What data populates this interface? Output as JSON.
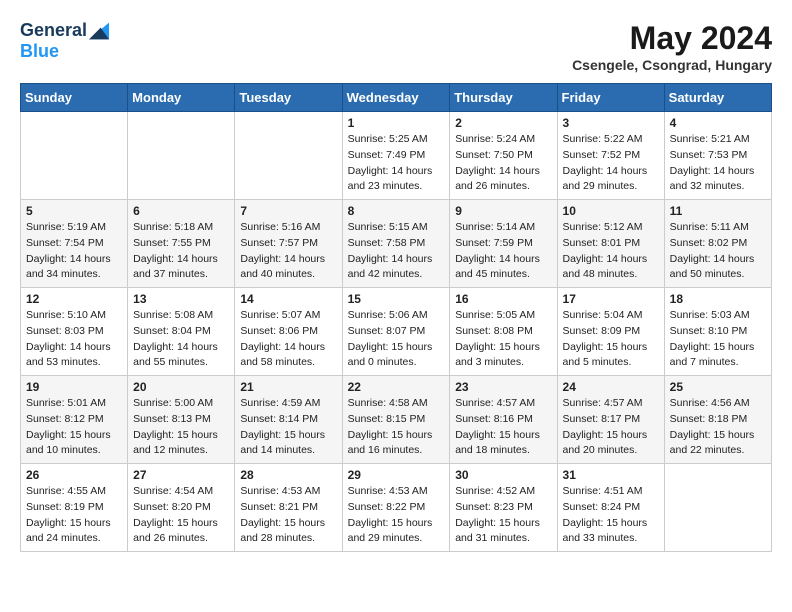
{
  "header": {
    "logo_general": "General",
    "logo_blue": "Blue",
    "month_year": "May 2024",
    "location": "Csengele, Csongrad, Hungary"
  },
  "weekdays": [
    "Sunday",
    "Monday",
    "Tuesday",
    "Wednesday",
    "Thursday",
    "Friday",
    "Saturday"
  ],
  "weeks": [
    [
      {
        "day": "",
        "info": ""
      },
      {
        "day": "",
        "info": ""
      },
      {
        "day": "",
        "info": ""
      },
      {
        "day": "1",
        "info": "Sunrise: 5:25 AM\nSunset: 7:49 PM\nDaylight: 14 hours\nand 23 minutes."
      },
      {
        "day": "2",
        "info": "Sunrise: 5:24 AM\nSunset: 7:50 PM\nDaylight: 14 hours\nand 26 minutes."
      },
      {
        "day": "3",
        "info": "Sunrise: 5:22 AM\nSunset: 7:52 PM\nDaylight: 14 hours\nand 29 minutes."
      },
      {
        "day": "4",
        "info": "Sunrise: 5:21 AM\nSunset: 7:53 PM\nDaylight: 14 hours\nand 32 minutes."
      }
    ],
    [
      {
        "day": "5",
        "info": "Sunrise: 5:19 AM\nSunset: 7:54 PM\nDaylight: 14 hours\nand 34 minutes."
      },
      {
        "day": "6",
        "info": "Sunrise: 5:18 AM\nSunset: 7:55 PM\nDaylight: 14 hours\nand 37 minutes."
      },
      {
        "day": "7",
        "info": "Sunrise: 5:16 AM\nSunset: 7:57 PM\nDaylight: 14 hours\nand 40 minutes."
      },
      {
        "day": "8",
        "info": "Sunrise: 5:15 AM\nSunset: 7:58 PM\nDaylight: 14 hours\nand 42 minutes."
      },
      {
        "day": "9",
        "info": "Sunrise: 5:14 AM\nSunset: 7:59 PM\nDaylight: 14 hours\nand 45 minutes."
      },
      {
        "day": "10",
        "info": "Sunrise: 5:12 AM\nSunset: 8:01 PM\nDaylight: 14 hours\nand 48 minutes."
      },
      {
        "day": "11",
        "info": "Sunrise: 5:11 AM\nSunset: 8:02 PM\nDaylight: 14 hours\nand 50 minutes."
      }
    ],
    [
      {
        "day": "12",
        "info": "Sunrise: 5:10 AM\nSunset: 8:03 PM\nDaylight: 14 hours\nand 53 minutes."
      },
      {
        "day": "13",
        "info": "Sunrise: 5:08 AM\nSunset: 8:04 PM\nDaylight: 14 hours\nand 55 minutes."
      },
      {
        "day": "14",
        "info": "Sunrise: 5:07 AM\nSunset: 8:06 PM\nDaylight: 14 hours\nand 58 minutes."
      },
      {
        "day": "15",
        "info": "Sunrise: 5:06 AM\nSunset: 8:07 PM\nDaylight: 15 hours\nand 0 minutes."
      },
      {
        "day": "16",
        "info": "Sunrise: 5:05 AM\nSunset: 8:08 PM\nDaylight: 15 hours\nand 3 minutes."
      },
      {
        "day": "17",
        "info": "Sunrise: 5:04 AM\nSunset: 8:09 PM\nDaylight: 15 hours\nand 5 minutes."
      },
      {
        "day": "18",
        "info": "Sunrise: 5:03 AM\nSunset: 8:10 PM\nDaylight: 15 hours\nand 7 minutes."
      }
    ],
    [
      {
        "day": "19",
        "info": "Sunrise: 5:01 AM\nSunset: 8:12 PM\nDaylight: 15 hours\nand 10 minutes."
      },
      {
        "day": "20",
        "info": "Sunrise: 5:00 AM\nSunset: 8:13 PM\nDaylight: 15 hours\nand 12 minutes."
      },
      {
        "day": "21",
        "info": "Sunrise: 4:59 AM\nSunset: 8:14 PM\nDaylight: 15 hours\nand 14 minutes."
      },
      {
        "day": "22",
        "info": "Sunrise: 4:58 AM\nSunset: 8:15 PM\nDaylight: 15 hours\nand 16 minutes."
      },
      {
        "day": "23",
        "info": "Sunrise: 4:57 AM\nSunset: 8:16 PM\nDaylight: 15 hours\nand 18 minutes."
      },
      {
        "day": "24",
        "info": "Sunrise: 4:57 AM\nSunset: 8:17 PM\nDaylight: 15 hours\nand 20 minutes."
      },
      {
        "day": "25",
        "info": "Sunrise: 4:56 AM\nSunset: 8:18 PM\nDaylight: 15 hours\nand 22 minutes."
      }
    ],
    [
      {
        "day": "26",
        "info": "Sunrise: 4:55 AM\nSunset: 8:19 PM\nDaylight: 15 hours\nand 24 minutes."
      },
      {
        "day": "27",
        "info": "Sunrise: 4:54 AM\nSunset: 8:20 PM\nDaylight: 15 hours\nand 26 minutes."
      },
      {
        "day": "28",
        "info": "Sunrise: 4:53 AM\nSunset: 8:21 PM\nDaylight: 15 hours\nand 28 minutes."
      },
      {
        "day": "29",
        "info": "Sunrise: 4:53 AM\nSunset: 8:22 PM\nDaylight: 15 hours\nand 29 minutes."
      },
      {
        "day": "30",
        "info": "Sunrise: 4:52 AM\nSunset: 8:23 PM\nDaylight: 15 hours\nand 31 minutes."
      },
      {
        "day": "31",
        "info": "Sunrise: 4:51 AM\nSunset: 8:24 PM\nDaylight: 15 hours\nand 33 minutes."
      },
      {
        "day": "",
        "info": ""
      }
    ]
  ]
}
